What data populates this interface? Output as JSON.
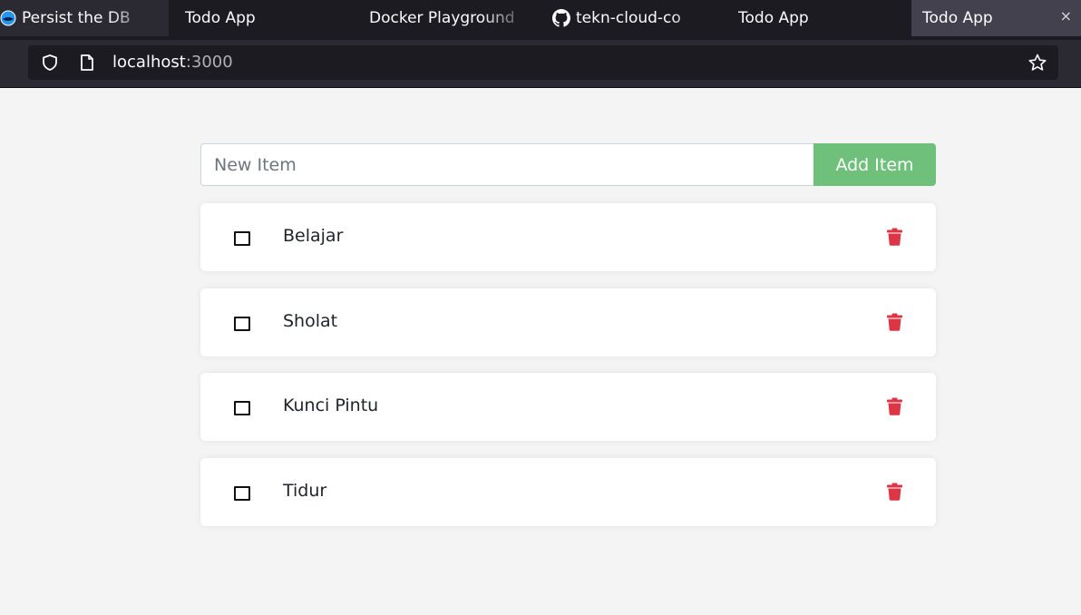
{
  "browser": {
    "tabs": [
      {
        "label": "Persist the DB",
        "active": false,
        "icon": "docker-whale-icon"
      },
      {
        "label": "Todo App",
        "active": false
      },
      {
        "label": "Docker Playground",
        "active": false
      },
      {
        "label": "tekn-cloud-co",
        "active": false,
        "icon": "github-icon"
      },
      {
        "label": "Todo App",
        "active": false
      },
      {
        "label": "Todo App",
        "active": true,
        "close": "×"
      }
    ],
    "url": {
      "host": "localhost",
      "port": ":3000"
    }
  },
  "form": {
    "placeholder": "New Item",
    "value": "",
    "add_label": "Add Item"
  },
  "items": [
    {
      "name": "Belajar",
      "completed": false
    },
    {
      "name": "Sholat",
      "completed": false
    },
    {
      "name": "Kunci Pintu",
      "completed": false
    },
    {
      "name": "Tidur",
      "completed": false
    }
  ],
  "colors": {
    "accent_green": "#6ec07b",
    "delete_red": "#dc3545",
    "page_bg": "#f4f4f4",
    "tabbar_bg": "#1c1b22"
  }
}
